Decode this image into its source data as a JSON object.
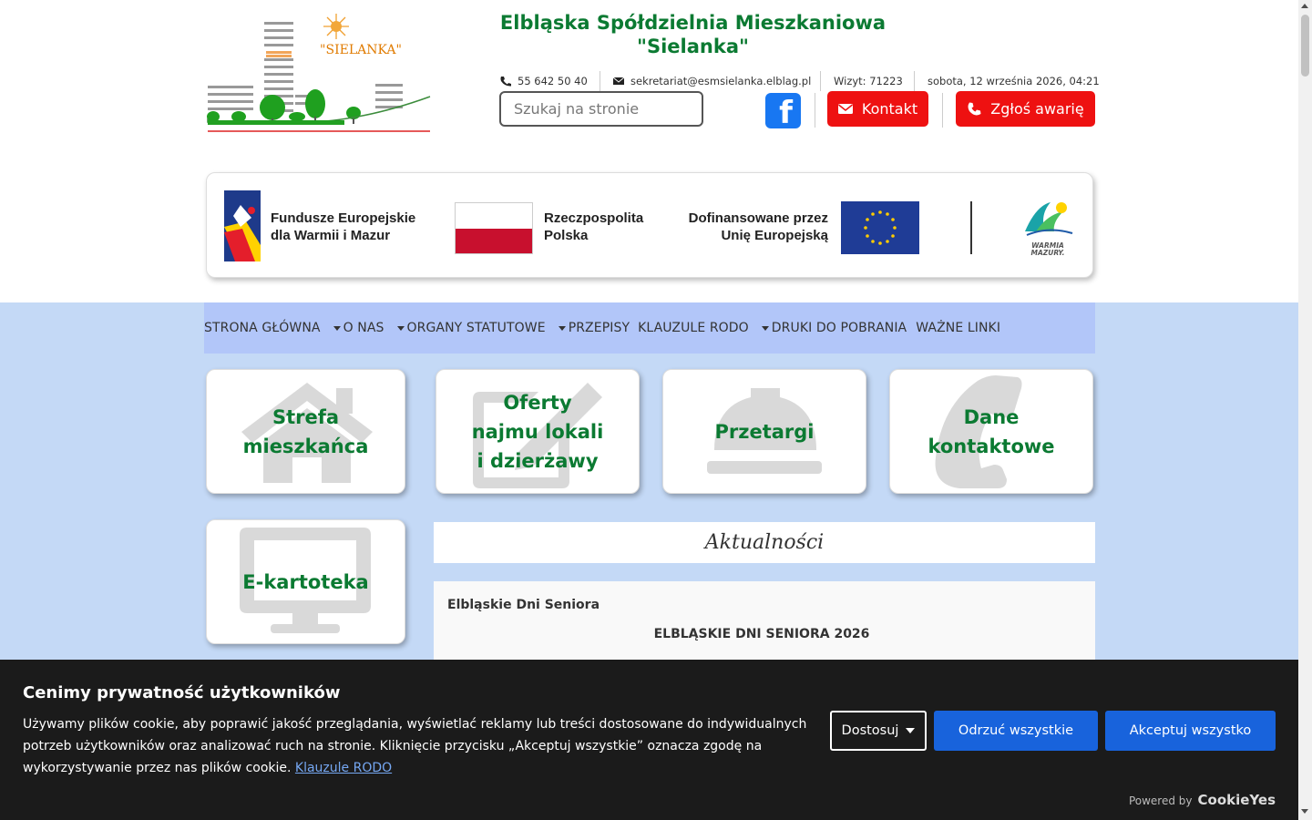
{
  "header": {
    "title": "Elbląska Spółdzielnia Mieszkaniowa \"Sielanka\"",
    "logo_text": "\"SIELANKA\"",
    "phone": "55 642 50 40",
    "email": "sekretariat@esmsielanka.elblag.pl",
    "visits": "Wizyt: 71223",
    "datetime": "sobota, 12 września 2026, 04:21",
    "search_placeholder": "Szukaj na stronie",
    "search_glyph": "",
    "facebook_letter": "f",
    "contact_label": "Kontakt",
    "report_label": "Zgłoś awarię"
  },
  "eu_banner": {
    "fe_line1": "Fundusze Europejskie",
    "fe_line2": "dla Warmii i Mazur",
    "rp_line1": "Rzeczpospolita",
    "rp_line2": "Polska",
    "ue_line1": "Dofinansowane przez",
    "ue_line2": "Unię Europejską",
    "wm_line1": "WARMIA",
    "wm_line2": "MAZURY."
  },
  "nav": {
    "items": [
      {
        "label": "STRONA GŁÓWNA",
        "dropdown": false
      },
      {
        "label": "O NAS",
        "dropdown": true
      },
      {
        "label": "ORGANY STATUTOWE",
        "dropdown": true
      },
      {
        "label": "PRZEPISY",
        "dropdown": true
      },
      {
        "label": "KLAUZULE RODO",
        "dropdown": false
      },
      {
        "label": "DRUKI DO POBRANIA",
        "dropdown": true
      },
      {
        "label": "WAŻNE LINKI",
        "dropdown": false
      }
    ]
  },
  "tiles": {
    "resident": {
      "line1": "Strefa",
      "line2": "mieszkańca",
      "icon": "home-icon"
    },
    "offers": {
      "line1": "Oferty",
      "line2": "najmu lokali",
      "line3": "i dzierżawy",
      "icon": "edit-icon"
    },
    "tenders": {
      "line1": "Przetargi",
      "icon": "hard-hat-icon"
    },
    "contact": {
      "line1": "Dane",
      "line2": "kontaktowe",
      "icon": "phone-icon"
    },
    "ekartoteka": {
      "line1": "E-kartoteka",
      "icon": "monitor-icon"
    }
  },
  "news": {
    "heading": "Aktualności",
    "item_title": "Elbląskie Dni Seniora",
    "item_subtitle": "ELBLĄSKIE DNI SENIORA 2026"
  },
  "cookie": {
    "title": "Cenimy prywatność użytkowników",
    "text": "Używamy plików cookie, aby poprawić jakość przeglądania, wyświetlać reklamy lub treści dostosowane do indywidualnych potrzeb użytkowników oraz analizować ruch na stronie. Kliknięcie przycisku „Akceptuj wszystkie” oznacza zgodę na wykorzystywanie przez nas plików cookie.",
    "link": "Klauzule RODO",
    "customize": "Dostosuj",
    "reject": "Odrzuć wszystkie",
    "accept": "Akceptuj wszystko",
    "powered_by": "Powered by",
    "brand": "CookieYes"
  },
  "colors": {
    "brand_green": "#0b7a32",
    "danger_red": "#ee1111",
    "nav_bg": "#b2c6f9",
    "band_bg": "#c4d9f6",
    "cookie_bg": "#1b1b1b",
    "cookie_blue": "#1863dc",
    "facebook_blue": "#1877f2"
  }
}
